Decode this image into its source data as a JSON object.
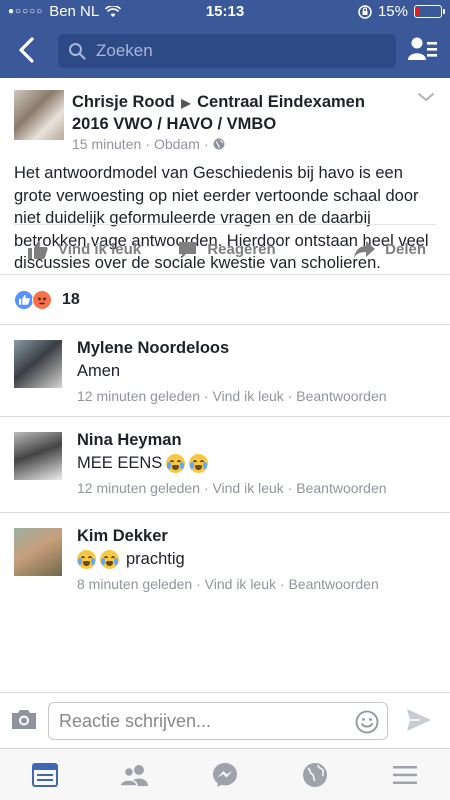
{
  "status_bar": {
    "carrier": "Ben NL",
    "time": "15:13",
    "battery": "15%",
    "battery_level": 0.15
  },
  "header": {
    "search_placeholder": "Zoeken"
  },
  "post": {
    "author": "Chrisje Rood",
    "group": "Centraal Eindexamen 2016 VWO / HAVO / VMBO",
    "time": "15 minuten",
    "location": "Obdam",
    "text": "Het antwoordmodel van Geschiedenis bij havo is een grote verwoesting op niet eerder vertoonde schaal door niet duidelijk geformuleerde vragen en de daarbij betrokken vage antwoorden. Hierdoor ontstaan heel veel discussies over de sociale kwestie van scholieren.",
    "actions": {
      "like": "Vind ik leuk",
      "comment": "Reageren",
      "share": "Delen"
    },
    "reaction_count": "18"
  },
  "comments": [
    {
      "name": "Mylene Noordeloos",
      "text": "Amen",
      "time": "12 minuten geleden",
      "like": "Vind ik leuk",
      "reply": "Beantwoorden"
    },
    {
      "name": "Nina Heyman",
      "text": "MEE EENS",
      "time": "12 minuten geleden",
      "like": "Vind ik leuk",
      "reply": "Beantwoorden"
    },
    {
      "name": "Kim Dekker",
      "text": "prachtig",
      "time": "8 minuten geleden",
      "like": "Vind ik leuk",
      "reply": "Beantwoorden"
    }
  ],
  "composer": {
    "placeholder": "Reactie schrijven..."
  },
  "colors": {
    "brand": "#3b5998",
    "like_blue": "#5890ff",
    "angry_orange": "#f7714b",
    "active_tab": "#4267b2"
  }
}
